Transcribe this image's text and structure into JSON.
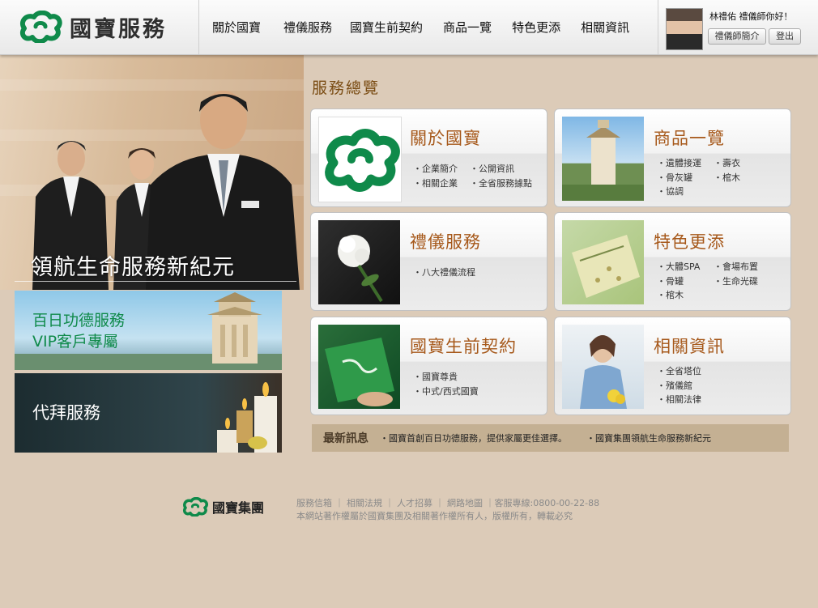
{
  "header": {
    "logo_text": "國寶服務",
    "nav": [
      "關於國寶",
      "禮儀服務",
      "國寶生前契約",
      "商品一覽",
      "特色更添",
      "相關資訊"
    ],
    "user": {
      "greeting": "林禮佑 禮儀師你好！",
      "profile_button": "禮儀師簡介",
      "logout_button": "登出"
    }
  },
  "hero": {
    "caption": "領航生命服務新紀元"
  },
  "promos": {
    "hundred_day_line1": "百日功德服務",
    "hundred_day_line2": "VIP客戶專屬",
    "worship_service": "代拜服務"
  },
  "overview": {
    "title": "服務總覽",
    "cards": [
      {
        "title": "關於國寶",
        "links": [
          "企業簡介",
          "公開資訊",
          "相關企業",
          "全省服務據點"
        ]
      },
      {
        "title": "商品一覽",
        "links": [
          "遺體接運",
          "壽衣",
          "骨灰罐",
          "棺木",
          "協調"
        ]
      },
      {
        "title": "禮儀服務",
        "links": [
          "八大禮儀流程"
        ]
      },
      {
        "title": "特色更添",
        "links": [
          "大體SPA",
          "會場布置",
          "骨罐",
          "生命光碟",
          "棺木"
        ]
      },
      {
        "title": "國寶生前契約",
        "links": [
          "國寶尊貴",
          "中式/西式國寶"
        ]
      },
      {
        "title": "相關資訊",
        "links": [
          "全省塔位",
          "殯儀館",
          "相關法律"
        ]
      }
    ]
  },
  "news": {
    "label": "最新訊息",
    "items": [
      "國寶首創百日功德服務，提供家屬更佳選擇。",
      "國寶集團領航生命服務新紀元"
    ]
  },
  "footer": {
    "logo_text": "國寶集團",
    "links": [
      "服務信箱",
      "相關法規",
      "人才招募",
      "網路地圖"
    ],
    "hotline": "客服專線:0800-00-22-88",
    "copyright": "本網站著作權屬於國寶集團及相關著作權所有人，版權所有，轉載必究"
  },
  "colors": {
    "brand_green": "#0f8a4a",
    "card_title": "#a6581a",
    "section_title": "#7a4c13",
    "page_bg": "#dccbb8"
  },
  "icons": [
    "brand-cloud-logo-icon",
    "footer-cloud-logo-icon"
  ]
}
